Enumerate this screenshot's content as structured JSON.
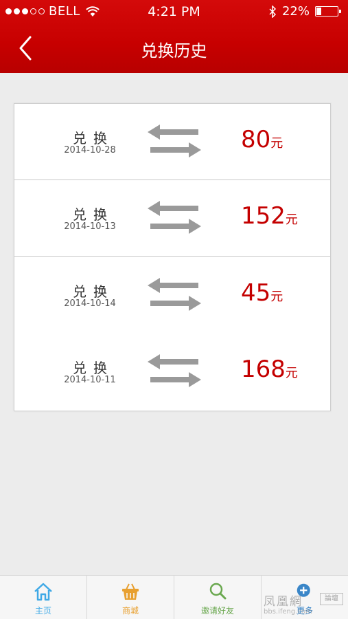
{
  "status_bar": {
    "carrier": "BELL",
    "time": "4:21 PM",
    "battery_text": "22%",
    "battery_level": 0.22
  },
  "nav": {
    "title": "兑换历史"
  },
  "records": [
    {
      "label": "兑换",
      "date": "2014-10-28",
      "amount": "80",
      "unit": "元"
    },
    {
      "label": "兑换",
      "date": "2014-10-13",
      "amount": "152",
      "unit": "元"
    },
    {
      "label": "兑换",
      "date": "2014-10-14",
      "amount": "45",
      "unit": "元"
    },
    {
      "label": "兑换",
      "date": "2014-10-11",
      "amount": "168",
      "unit": "元"
    }
  ],
  "tabs": [
    {
      "label": "主页",
      "icon": "home-icon",
      "color": "#3fa9e6"
    },
    {
      "label": "商城",
      "icon": "basket-icon",
      "color": "#e8a030"
    },
    {
      "label": "邀请好友",
      "icon": "search-icon",
      "color": "#6aa84f"
    },
    {
      "label": "更多",
      "icon": "plus-circle-icon",
      "color": "#3a86c8"
    }
  ],
  "watermark": {
    "text": "凤凰網",
    "sub": "bbs.ifeng.com",
    "box": "論壇"
  },
  "colors": {
    "header": "#c70000",
    "amount": "#c40000",
    "arrow": "#9a9a9a"
  }
}
